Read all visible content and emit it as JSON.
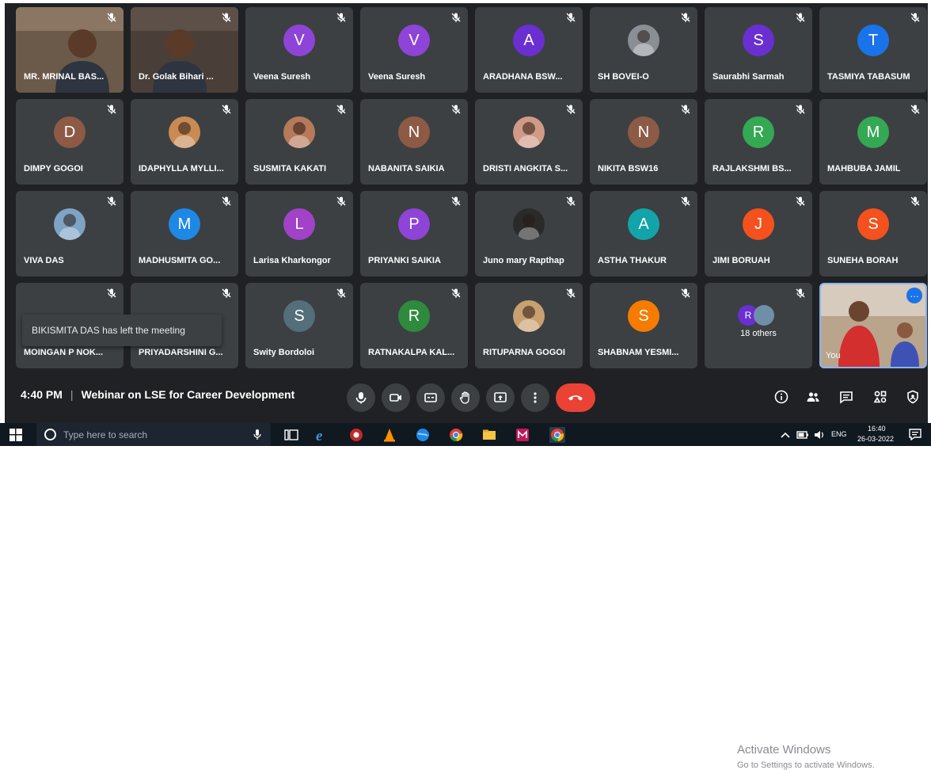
{
  "tiles": [
    {
      "name": "MR. MRINAL BAS...",
      "kind": "video"
    },
    {
      "name": "Dr. Golak Bihari ...",
      "kind": "video"
    },
    {
      "name": "Veena Suresh",
      "kind": "letter",
      "letter": "V",
      "color": "#8e44d6"
    },
    {
      "name": "Veena Suresh",
      "kind": "letter",
      "letter": "V",
      "color": "#8e44d6"
    },
    {
      "name": "ARADHANA BSW...",
      "kind": "letter",
      "letter": "A",
      "color": "#6a2fd1"
    },
    {
      "name": "SH BOVEI-O",
      "kind": "photo",
      "tone": "#8a8f96"
    },
    {
      "name": "Saurabhi Sarmah",
      "kind": "letter",
      "letter": "S",
      "color": "#6a2fd1"
    },
    {
      "name": "TASMIYA TABASUM",
      "kind": "letter",
      "letter": "T",
      "color": "#1a73e8"
    },
    {
      "name": "DIMPY GOGOI",
      "kind": "letter",
      "letter": "D",
      "color": "#8d5a45"
    },
    {
      "name": "IDAPHYLLA MYLLI...",
      "kind": "photo",
      "tone": "#c98a54"
    },
    {
      "name": "SUSMITA KAKATI",
      "kind": "photo",
      "tone": "#b57a5a"
    },
    {
      "name": "NABANITA SAIKIA",
      "kind": "letter",
      "letter": "N",
      "color": "#8d5a45"
    },
    {
      "name": "DRISTI ANGKITA S...",
      "kind": "photo",
      "tone": "#d09a86"
    },
    {
      "name": "NIKITA BSW16",
      "kind": "letter",
      "letter": "N",
      "color": "#8d5a45"
    },
    {
      "name": "RAJLAKSHMI BS...",
      "kind": "letter",
      "letter": "R",
      "color": "#34a853"
    },
    {
      "name": "MAHBUBA JAMIL",
      "kind": "letter",
      "letter": "M",
      "color": "#34a853"
    },
    {
      "name": "VIVA DAS",
      "kind": "photo",
      "tone": "#7fa3c4"
    },
    {
      "name": "MADHUSMITA GO...",
      "kind": "letter",
      "letter": "M",
      "color": "#1e88e5"
    },
    {
      "name": "Larisa Kharkongor",
      "kind": "letter",
      "letter": "L",
      "color": "#a142c8"
    },
    {
      "name": "PRIYANKI SAIKIA",
      "kind": "letter",
      "letter": "P",
      "color": "#8e44d6"
    },
    {
      "name": "Juno mary Rapthap",
      "kind": "photo",
      "tone": "#2a2a2a"
    },
    {
      "name": "ASTHA THAKUR",
      "kind": "letter",
      "letter": "A",
      "color": "#12a4a8"
    },
    {
      "name": "JIMI BORUAH",
      "kind": "letter",
      "letter": "J",
      "color": "#f4511e"
    },
    {
      "name": "SUNEHA BORAH",
      "kind": "letter",
      "letter": "S",
      "color": "#f4511e"
    },
    {
      "name": "MOINGAN P NOK...",
      "kind": "letter",
      "letter": "",
      "color": "#3c4043"
    },
    {
      "name": "PRIYADARSHINI G...",
      "kind": "letter",
      "letter": "",
      "color": "#3c4043"
    },
    {
      "name": "Swity Bordoloi",
      "kind": "letter",
      "letter": "S",
      "color": "#546e7a"
    },
    {
      "name": "RATNAKALPA KAL...",
      "kind": "letter",
      "letter": "R",
      "color": "#2e8b3e"
    },
    {
      "name": "RITUPARNA GOGOI",
      "kind": "photo",
      "tone": "#c9a070"
    },
    {
      "name": "SHABNAM YESMI...",
      "kind": "letter",
      "letter": "S",
      "color": "#f57c00"
    },
    {
      "name": "18 others",
      "kind": "others",
      "letter": "R",
      "color": "#6a2fd1"
    },
    {
      "name": "You",
      "kind": "self"
    }
  ],
  "toast": "BIKISMITA DAS has left the meeting",
  "meeting": {
    "time": "4:40 PM",
    "title": "Webinar on LSE for Career Development"
  },
  "watermark": {
    "line1": "Activate Windows",
    "line2": "Go to Settings to activate Windows."
  },
  "taskbar": {
    "search_placeholder": "Type here to search",
    "lang": "ENG",
    "time": "16:40",
    "date": "26-03-2022"
  },
  "colors": {
    "end_call": "#ea4335",
    "tile_bg": "#3c4043",
    "meet_bg": "#202124",
    "self_border": "#8ab4f8"
  }
}
